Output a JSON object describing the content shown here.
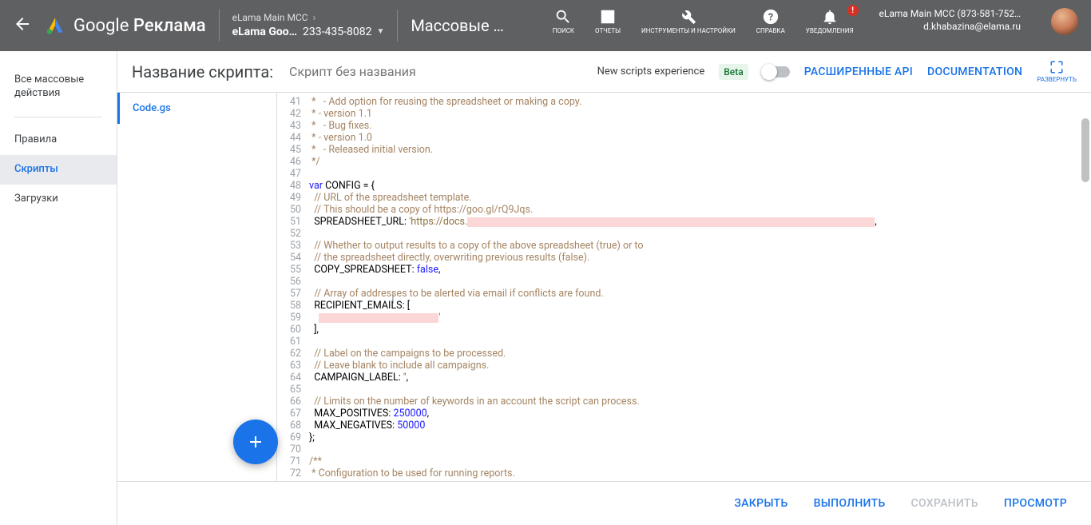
{
  "header": {
    "product": "Google",
    "product2": "Реклама",
    "account_top": "eLama Main MCC",
    "account_main": "eLama Goo…",
    "account_id": "233-435-8082",
    "crumb": "Массовые …",
    "tools": {
      "search": "ПОИСК",
      "reports": "ОТЧЕТЫ",
      "tools": "ИНСТРУМЕНТЫ И НАСТРОЙКИ",
      "help": "СПРАВКА",
      "notif": "УВЕДОМЛЕНИЯ",
      "badge": "!"
    },
    "user_line1": "eLama Main MCC (873-581-752…",
    "user_line2": "d.khabazina@elama.ru"
  },
  "nav": {
    "all": "Все массовые действия",
    "rules": "Правила",
    "scripts": "Скрипты",
    "uploads": "Загрузки"
  },
  "shead": {
    "label": "Название скрипта:",
    "placeholder": "Скрипт без названия",
    "nse": "New scripts experience",
    "beta": "Beta",
    "api": "РАСШИРЕННЫЕ API",
    "doc": "DOCUMENTATION",
    "expand": "РАЗВЕРНУТЬ"
  },
  "files": {
    "f1": "Code.gs"
  },
  "footer": {
    "close": "ЗАКРЫТЬ",
    "run": "ВЫПОЛНИТЬ",
    "save": "СОХРАНИТЬ",
    "preview": "ПРОСМОТР"
  },
  "code": {
    "l41": " *   - Add option for reusing the spreadsheet or making a copy.",
    "l42": " * - version 1.1",
    "l43": " *   - Bug fixes.",
    "l44": " * - version 1.0",
    "l45": " *   - Released initial version.",
    "l46": " */",
    "l48a": "var",
    "l48b": " CONFIG = {",
    "l49": "  // URL of the spreadsheet template.",
    "l50": "  // This should be a copy of https://goo.gl/rQ9Jqs.",
    "l51a": "  SPREADSHEET_URL: ",
    "l51b": "'https://docs.",
    "l51c": ",",
    "l53": "  // Whether to output results to a copy of the above spreadsheet (true) or to",
    "l54": "  // the spreadsheet directly, overwriting previous results (false).",
    "l55a": "  COPY_SPREADSHEET: ",
    "l55b": "false",
    "l55c": ",",
    "l57": "  // Array of addresses to be alerted via email if conflicts are found.",
    "l58": "  RECIPIENT_EMAILS: [",
    "l59a": "    ",
    "l59b": "'",
    "l60": "  ],",
    "l62": "  // Label on the campaigns to be processed.",
    "l63": "  // Leave blank to include all campaigns.",
    "l64a": "  CAMPAIGN_LABEL: ",
    "l64b": "''",
    "l64c": ",",
    "l66": "  // Limits on the number of keywords in an account the script can process.",
    "l67a": "  MAX_POSITIVES: ",
    "l67b": "250000",
    "l67c": ",",
    "l68a": "  MAX_NEGATIVES: ",
    "l68b": "50000",
    "l69": "};",
    "l71": "/**",
    "l72": " * Configuration to be used for running reports."
  }
}
